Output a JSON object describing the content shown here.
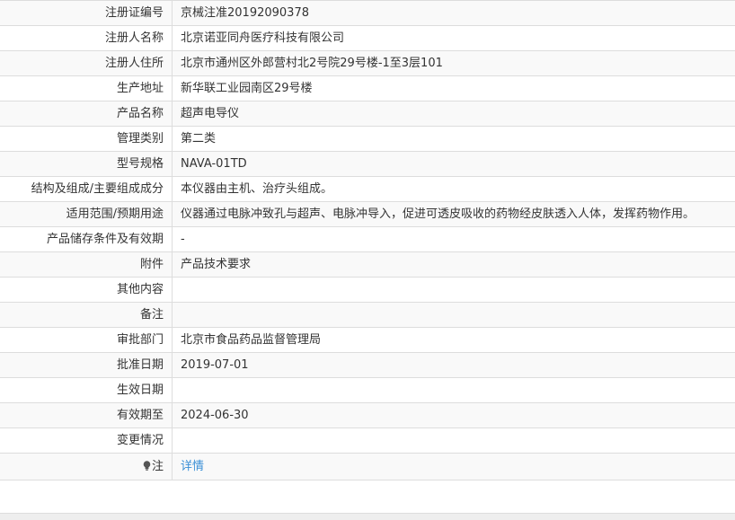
{
  "rows": [
    {
      "label": "注册证编号",
      "value": "京械注准20192090378"
    },
    {
      "label": "注册人名称",
      "value": "北京诺亚同舟医疗科技有限公司"
    },
    {
      "label": "注册人住所",
      "value": "北京市通州区外郎营村北2号院29号楼-1至3层101"
    },
    {
      "label": "生产地址",
      "value": "新华联工业园南区29号楼"
    },
    {
      "label": "产品名称",
      "value": "超声电导仪"
    },
    {
      "label": "管理类别",
      "value": "第二类"
    },
    {
      "label": "型号规格",
      "value": "NAVA-01TD"
    },
    {
      "label": "结构及组成/主要组成成分",
      "value": "本仪器由主机、治疗头组成。"
    },
    {
      "label": "适用范围/预期用途",
      "value": "仪器通过电脉冲致孔与超声、电脉冲导入，促进可透皮吸收的药物经皮肤透入人体，发挥药物作用。"
    },
    {
      "label": "产品储存条件及有效期",
      "value": "-"
    },
    {
      "label": "附件",
      "value": "产品技术要求"
    },
    {
      "label": "其他内容",
      "value": ""
    },
    {
      "label": "备注",
      "value": ""
    },
    {
      "label": "审批部门",
      "value": "北京市食品药品监督管理局"
    },
    {
      "label": "批准日期",
      "value": "2019-07-01"
    },
    {
      "label": "生效日期",
      "value": ""
    },
    {
      "label": "有效期至",
      "value": "2024-06-30"
    },
    {
      "label": "变更情况",
      "value": ""
    }
  ],
  "note": {
    "label": "注",
    "icon": "lightbulb-icon",
    "link_text": "详情",
    "link_color": "#3a8fd6"
  }
}
